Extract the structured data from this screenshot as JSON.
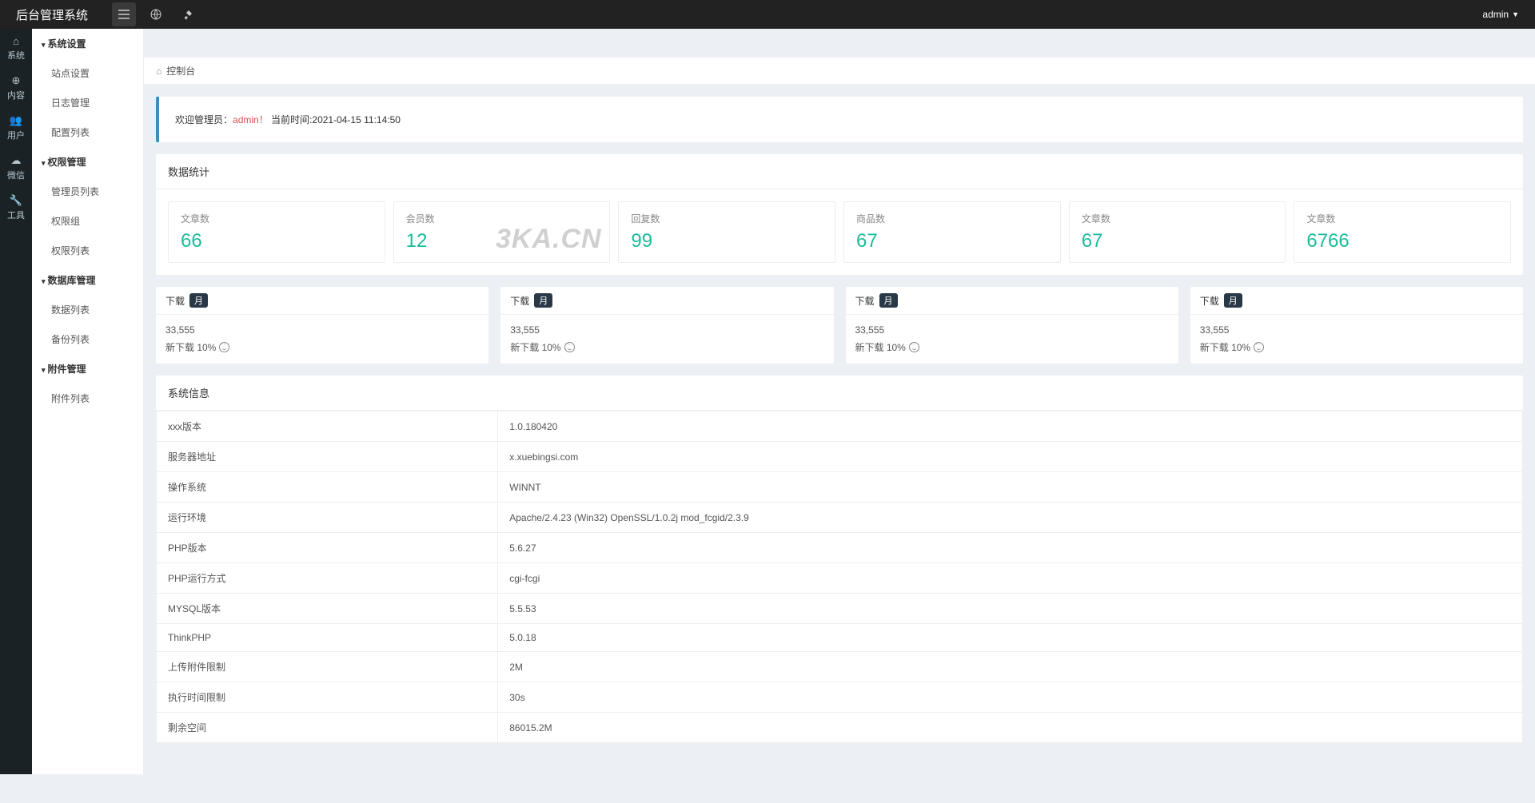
{
  "topbar": {
    "title": "后台管理系统",
    "user": "admin"
  },
  "leftstrip": [
    {
      "icon": "home",
      "label": "系统"
    },
    {
      "icon": "plus",
      "label": "内容"
    },
    {
      "icon": "users",
      "label": "用户"
    },
    {
      "icon": "wechat",
      "label": "微信"
    },
    {
      "icon": "wrench",
      "label": "工具"
    }
  ],
  "sidebar": [
    {
      "type": "group",
      "label": "系统设置"
    },
    {
      "type": "item",
      "label": "站点设置"
    },
    {
      "type": "item",
      "label": "日志管理"
    },
    {
      "type": "item",
      "label": "配置列表"
    },
    {
      "type": "group",
      "label": "权限管理"
    },
    {
      "type": "item",
      "label": "管理员列表"
    },
    {
      "type": "item",
      "label": "权限组"
    },
    {
      "type": "item",
      "label": "权限列表"
    },
    {
      "type": "group",
      "label": "数据库管理"
    },
    {
      "type": "item",
      "label": "数据列表"
    },
    {
      "type": "item",
      "label": "备份列表"
    },
    {
      "type": "group",
      "label": "附件管理"
    },
    {
      "type": "item",
      "label": "附件列表"
    }
  ],
  "breadcrumb": {
    "label": "控制台"
  },
  "welcome": {
    "prefix": "欢迎管理员：",
    "admin": "admin！",
    "time_label": "当前时间:",
    "time_value": "2021-04-15 11:14:50"
  },
  "stats_panel": {
    "title": "数据统计",
    "cards": [
      {
        "label": "文章数",
        "value": "66"
      },
      {
        "label": "会员数",
        "value": "12"
      },
      {
        "label": "回复数",
        "value": "99"
      },
      {
        "label": "商品数",
        "value": "67"
      },
      {
        "label": "文章数",
        "value": "67"
      },
      {
        "label": "文章数",
        "value": "6766"
      }
    ]
  },
  "downloads": [
    {
      "title": "下载",
      "badge": "月",
      "num": "33,555",
      "sub": "新下载 10%"
    },
    {
      "title": "下载",
      "badge": "月",
      "num": "33,555",
      "sub": "新下载 10%"
    },
    {
      "title": "下载",
      "badge": "月",
      "num": "33,555",
      "sub": "新下载 10%"
    },
    {
      "title": "下载",
      "badge": "月",
      "num": "33,555",
      "sub": "新下载 10%"
    }
  ],
  "sysinfo": {
    "title": "系统信息",
    "rows": [
      {
        "k": "xxx版本",
        "v": "1.0.180420"
      },
      {
        "k": "服务器地址",
        "v": "x.xuebingsi.com"
      },
      {
        "k": "操作系统",
        "v": "WINNT"
      },
      {
        "k": "运行环境",
        "v": "Apache/2.4.23 (Win32) OpenSSL/1.0.2j mod_fcgid/2.3.9"
      },
      {
        "k": "PHP版本",
        "v": "5.6.27"
      },
      {
        "k": "PHP运行方式",
        "v": "cgi-fcgi"
      },
      {
        "k": "MYSQL版本",
        "v": "5.5.53"
      },
      {
        "k": "ThinkPHP",
        "v": "5.0.18"
      },
      {
        "k": "上传附件限制",
        "v": "2M"
      },
      {
        "k": "执行时间限制",
        "v": "30s"
      },
      {
        "k": "剩余空间",
        "v": "86015.2M"
      }
    ]
  },
  "watermark": "3KA.CN"
}
